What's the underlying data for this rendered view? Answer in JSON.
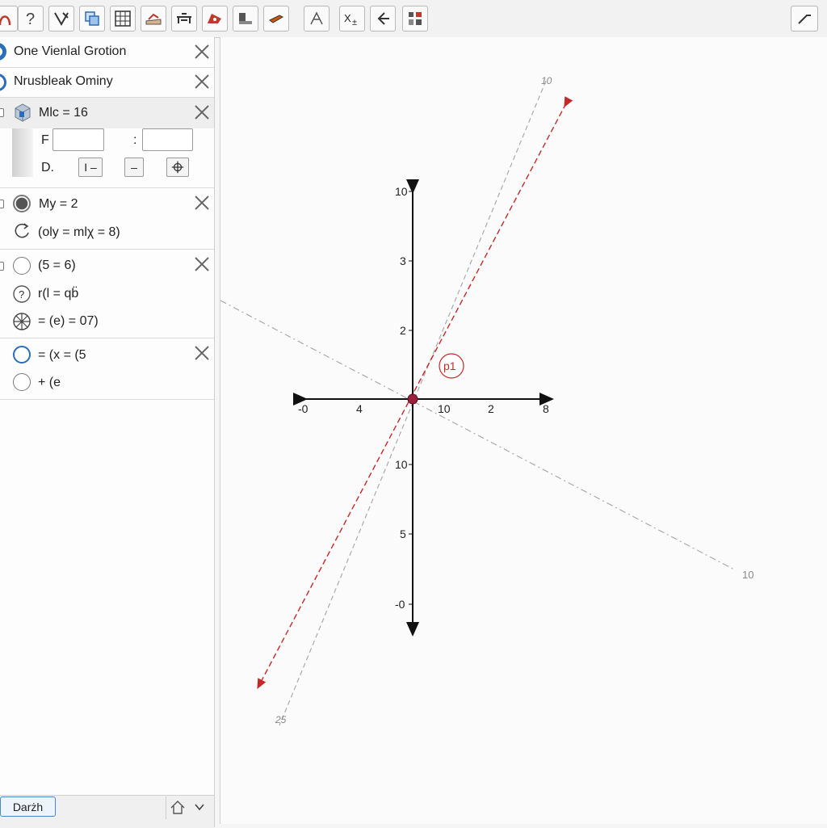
{
  "toolbar": {
    "tools": [
      {
        "icon": "curve-arrow-icon"
      },
      {
        "icon": "help-question-icon"
      },
      {
        "icon": "move-tool-icon"
      },
      {
        "icon": "copy-tool-icon"
      },
      {
        "icon": "spreadsheet-grid-icon"
      },
      {
        "icon": "graph-tool-icon"
      },
      {
        "icon": "bench-tool-icon"
      },
      {
        "icon": "slope-tool-icon"
      },
      {
        "icon": "object-tool-icon"
      },
      {
        "icon": "pencil-tool-icon"
      },
      {
        "icon": "transform-tool-icon"
      },
      {
        "icon": "xy-tool-icon"
      },
      {
        "icon": "back-arrow-tool-icon"
      },
      {
        "icon": "grid-options-icon"
      }
    ],
    "right_tool": {
      "icon": "redo-arrow-icon"
    }
  },
  "algebra": {
    "items": [
      {
        "label": "One Vienlal Grotion"
      },
      {
        "label": "Nrusbleak Ominy"
      },
      {
        "label": "Mlc = 16",
        "field1_label": "F",
        "field2_label": ":",
        "field3_label": "D.",
        "btn1": "I –",
        "btn2": "–"
      },
      {
        "label": "My = 2",
        "sub_label": "(oly = mlχ = 8)"
      },
      {
        "label": "(5 = 6)",
        "sub1": "r(l = qb̈",
        "sub2": "= (e) = 07)"
      },
      {
        "label": "= (x = (5",
        "sub_label": "+ (e"
      }
    ],
    "input_button": "Darżh"
  },
  "graphics": {
    "x_ticks": [
      "-0",
      "4",
      "10",
      "2",
      "8"
    ],
    "y_ticks": [
      "10",
      "3",
      "2",
      "10",
      "5",
      "-0"
    ],
    "point_label": "p1",
    "line_labels": [
      "10",
      "10",
      "25"
    ]
  }
}
